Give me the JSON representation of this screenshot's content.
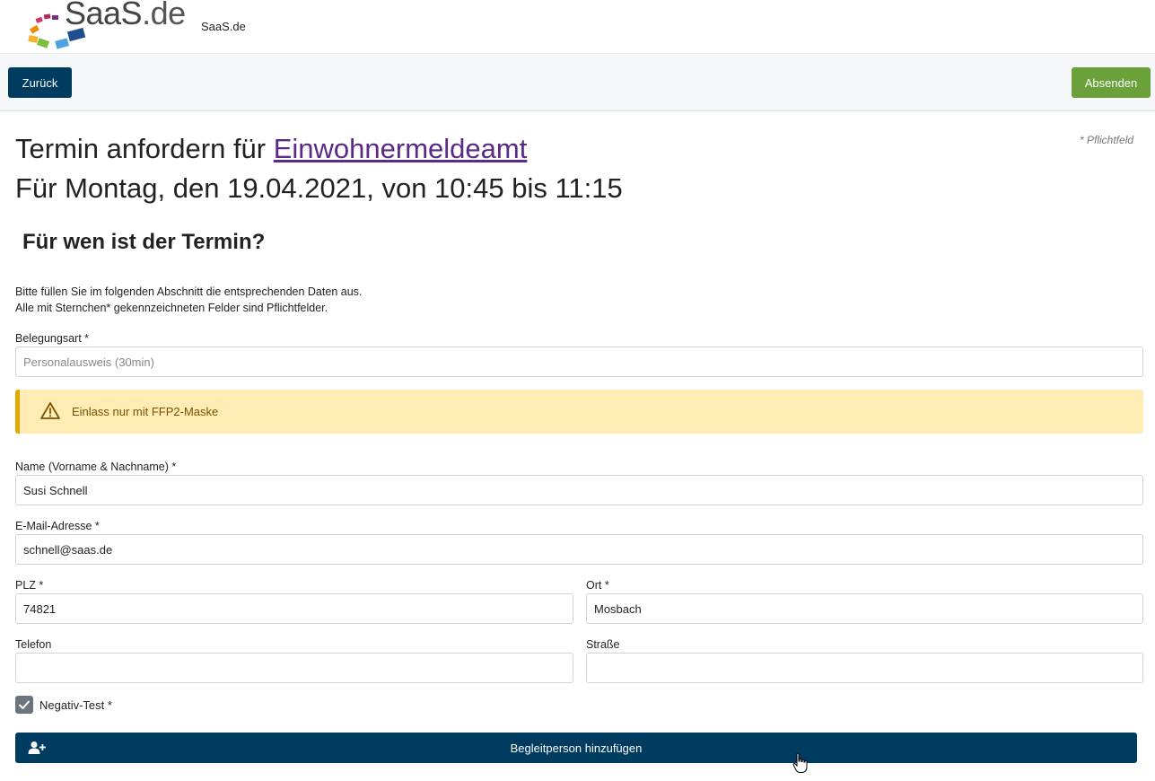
{
  "header": {
    "logo_text": "SaaS",
    "logo_tld": ".de",
    "site_name": "SaaS.de"
  },
  "toolbar": {
    "back_label": "Zurück",
    "submit_label": "Absenden"
  },
  "page": {
    "required_note": "* Pflichtfeld",
    "title_prefix": "Termin anfordern für ",
    "title_link": "Einwohnermeldeamt",
    "title_date": "Für Montag, den 19.04.2021, von 10:45 bis 11:15",
    "section_title": "Für wen ist der Termin?",
    "intro_line1": "Bitte füllen Sie im folgenden Abschnitt die entsprechenden Daten aus.",
    "intro_line2": "Alle mit Sternchen* gekennzeichneten Felder sind Pflichtfelder."
  },
  "form": {
    "belegungsart": {
      "label": "Belegungsart *",
      "value": "Personalausweis (30min)"
    },
    "alert_text": "Einlass nur mit FFP2-Maske",
    "name": {
      "label": "Name (Vorname & Nachname) *",
      "value": "Susi Schnell"
    },
    "email": {
      "label": "E-Mail-Adresse *",
      "value": "schnell@saas.de"
    },
    "plz": {
      "label": "PLZ *",
      "value": "74821"
    },
    "ort": {
      "label": "Ort *",
      "value": "Mosbach"
    },
    "telefon": {
      "label": "Telefon",
      "value": ""
    },
    "strasse": {
      "label": "Straße",
      "value": ""
    },
    "negativ_test": {
      "label": "Negativ-Test *",
      "checked": true
    },
    "companion_button": "Begleitperson hinzufügen"
  },
  "colors": {
    "primary": "#003c5f",
    "success": "#6aa13a",
    "alert_bg": "#ffecb5",
    "alert_border": "#e0a800",
    "link": "#5b2a86"
  },
  "icons": {
    "alert": "warning-triangle-icon",
    "companion": "user-plus-icon",
    "checkbox": "check-icon"
  }
}
